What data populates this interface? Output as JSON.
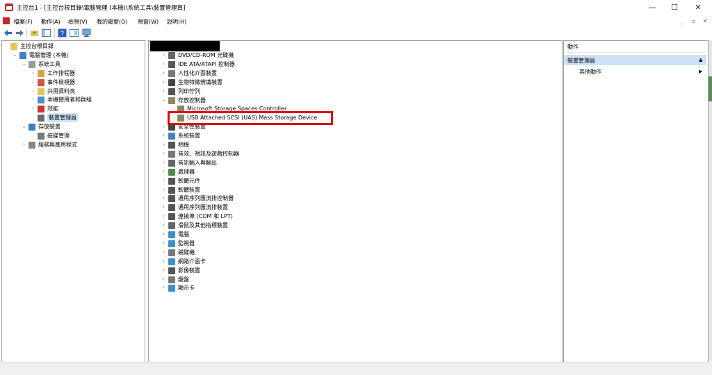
{
  "window": {
    "title": "主控台1 - [主控台根目錄\\電腦管理 (本機)\\系統工具\\裝置管理員]",
    "minimize_glyph": "—",
    "maximize_glyph": "☐",
    "close_glyph": "✕"
  },
  "menu": {
    "items": [
      "檔案(F)",
      "動作(A)",
      "檢視(V)",
      "我的最愛(O)",
      "視窗(W)",
      "說明(H)"
    ],
    "mdi_min": "_",
    "mdi_restore": "▫",
    "mdi_close": "✕"
  },
  "toolbar": {
    "icons": [
      "back-arrow-icon",
      "forward-arrow-icon",
      "up-folder-icon",
      "show-hide-tree-icon",
      "help-icon",
      "properties-icon",
      "monitor-icon"
    ]
  },
  "left_tree": {
    "items": [
      {
        "label": "主控台根目錄",
        "icon": "folder-icon",
        "arrow": "",
        "indent": 0
      },
      {
        "label": "電腦管理 (本機)",
        "icon": "computer-management-icon",
        "arrow": "⌄",
        "indent": 1
      },
      {
        "label": "系統工具",
        "icon": "tools-icon",
        "arrow": "⌄",
        "indent": 2
      },
      {
        "label": "工作排程器",
        "icon": "clock-icon",
        "arrow": "›",
        "indent": 3
      },
      {
        "label": "事件檢視器",
        "icon": "event-viewer-icon",
        "arrow": "›",
        "indent": 3
      },
      {
        "label": "共用資料夾",
        "icon": "shared-folder-icon",
        "arrow": "›",
        "indent": 3
      },
      {
        "label": "本機使用者和群組",
        "icon": "users-icon",
        "arrow": "›",
        "indent": 3
      },
      {
        "label": "效能",
        "icon": "performance-icon",
        "arrow": "›",
        "indent": 3
      },
      {
        "label": "裝置管理員",
        "icon": "device-manager-icon",
        "arrow": "",
        "indent": 3,
        "selected": true
      },
      {
        "label": "存放裝置",
        "icon": "storage-icon",
        "arrow": "⌄",
        "indent": 2
      },
      {
        "label": "磁碟管理",
        "icon": "disk-management-icon",
        "arrow": "",
        "indent": 3
      },
      {
        "label": "服務與應用程式",
        "icon": "services-icon",
        "arrow": "›",
        "indent": 2
      }
    ]
  },
  "device_tree": {
    "items": [
      {
        "label": "DVD/CD-ROM 光碟機",
        "icon": "dvd-drive-icon",
        "arrow": "›",
        "indent": 0
      },
      {
        "label": "IDE ATA/ATAPI 控制器",
        "icon": "ide-controller-icon",
        "arrow": "›",
        "indent": 0
      },
      {
        "label": "人性化介面裝置",
        "icon": "hid-icon",
        "arrow": "›",
        "indent": 0
      },
      {
        "label": "生物特徵辨識裝置",
        "icon": "biometric-icon",
        "arrow": "›",
        "indent": 0
      },
      {
        "label": "列印佇列",
        "icon": "printer-icon",
        "arrow": "›",
        "indent": 0
      },
      {
        "label": "存放控制器",
        "icon": "storage-controller-icon",
        "arrow": "⌄",
        "indent": 0
      },
      {
        "label": "Microsoft Storage Spaces Controller",
        "icon": "storage-controller-icon",
        "arrow": "",
        "indent": 1
      },
      {
        "label": "USB Attached SCSI (UAS) Mass Storage Device",
        "icon": "storage-controller-icon",
        "arrow": "",
        "indent": 1,
        "highlight": true
      },
      {
        "label": "安全性裝置",
        "icon": "security-device-icon",
        "arrow": "›",
        "indent": 0
      },
      {
        "label": "系統裝置",
        "icon": "system-device-icon",
        "arrow": "›",
        "indent": 0
      },
      {
        "label": "相機",
        "icon": "camera-icon",
        "arrow": "›",
        "indent": 0
      },
      {
        "label": "音效、視訊及遊戲控制器",
        "icon": "sound-icon",
        "arrow": "›",
        "indent": 0
      },
      {
        "label": "音訊輸入與輸出",
        "icon": "audio-io-icon",
        "arrow": "›",
        "indent": 0
      },
      {
        "label": "處理器",
        "icon": "processor-icon",
        "arrow": "›",
        "indent": 0
      },
      {
        "label": "軟體元件",
        "icon": "software-component-icon",
        "arrow": "›",
        "indent": 0
      },
      {
        "label": "軟體裝置",
        "icon": "software-device-icon",
        "arrow": "›",
        "indent": 0
      },
      {
        "label": "通用序列匯流排控制器",
        "icon": "usb-icon",
        "arrow": "›",
        "indent": 0
      },
      {
        "label": "通用序列匯流排裝置",
        "icon": "usb-icon",
        "arrow": "›",
        "indent": 0
      },
      {
        "label": "連接埠 (COM 和 LPT)",
        "icon": "port-icon",
        "arrow": "›",
        "indent": 0
      },
      {
        "label": "滑鼠及其他指標裝置",
        "icon": "mouse-icon",
        "arrow": "›",
        "indent": 0
      },
      {
        "label": "電腦",
        "icon": "computer-icon",
        "arrow": "›",
        "indent": 0
      },
      {
        "label": "監視器",
        "icon": "monitor-icon",
        "arrow": "›",
        "indent": 0
      },
      {
        "label": "磁碟機",
        "icon": "disk-drive-icon",
        "arrow": "›",
        "indent": 0
      },
      {
        "label": "網路介面卡",
        "icon": "network-adapter-icon",
        "arrow": "›",
        "indent": 0
      },
      {
        "label": "影像裝置",
        "icon": "imaging-device-icon",
        "arrow": "›",
        "indent": 0
      },
      {
        "label": "鍵盤",
        "icon": "keyboard-icon",
        "arrow": "›",
        "indent": 0
      },
      {
        "label": "顯示卡",
        "icon": "display-adapter-icon",
        "arrow": "›",
        "indent": 0
      }
    ]
  },
  "actions_pane": {
    "header": "動作",
    "section": "裝置管理員",
    "section_arrow": "▲",
    "more_actions": "其他動作",
    "more_arrow": "▶"
  },
  "colors": {
    "highlight_box": "#e0000f",
    "selection": "#cde1f7"
  }
}
